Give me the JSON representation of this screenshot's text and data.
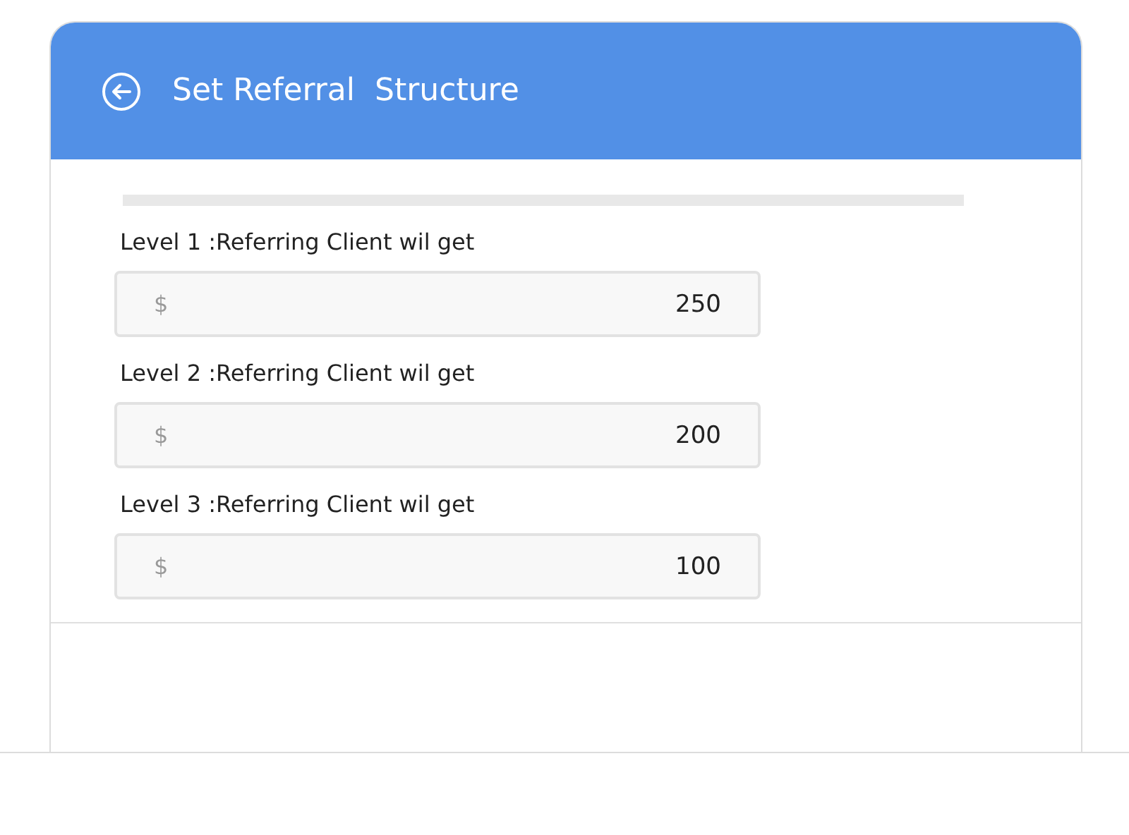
{
  "header": {
    "title": "Set Referral  Structure"
  },
  "levels": [
    {
      "label": "Level 1 :Referring Client wil get",
      "currency": "$",
      "value": "250"
    },
    {
      "label": "Level 2 :Referring Client wil get",
      "currency": "$",
      "value": "200"
    },
    {
      "label": "Level 3 :Referring Client wil get",
      "currency": "$",
      "value": "100"
    }
  ]
}
